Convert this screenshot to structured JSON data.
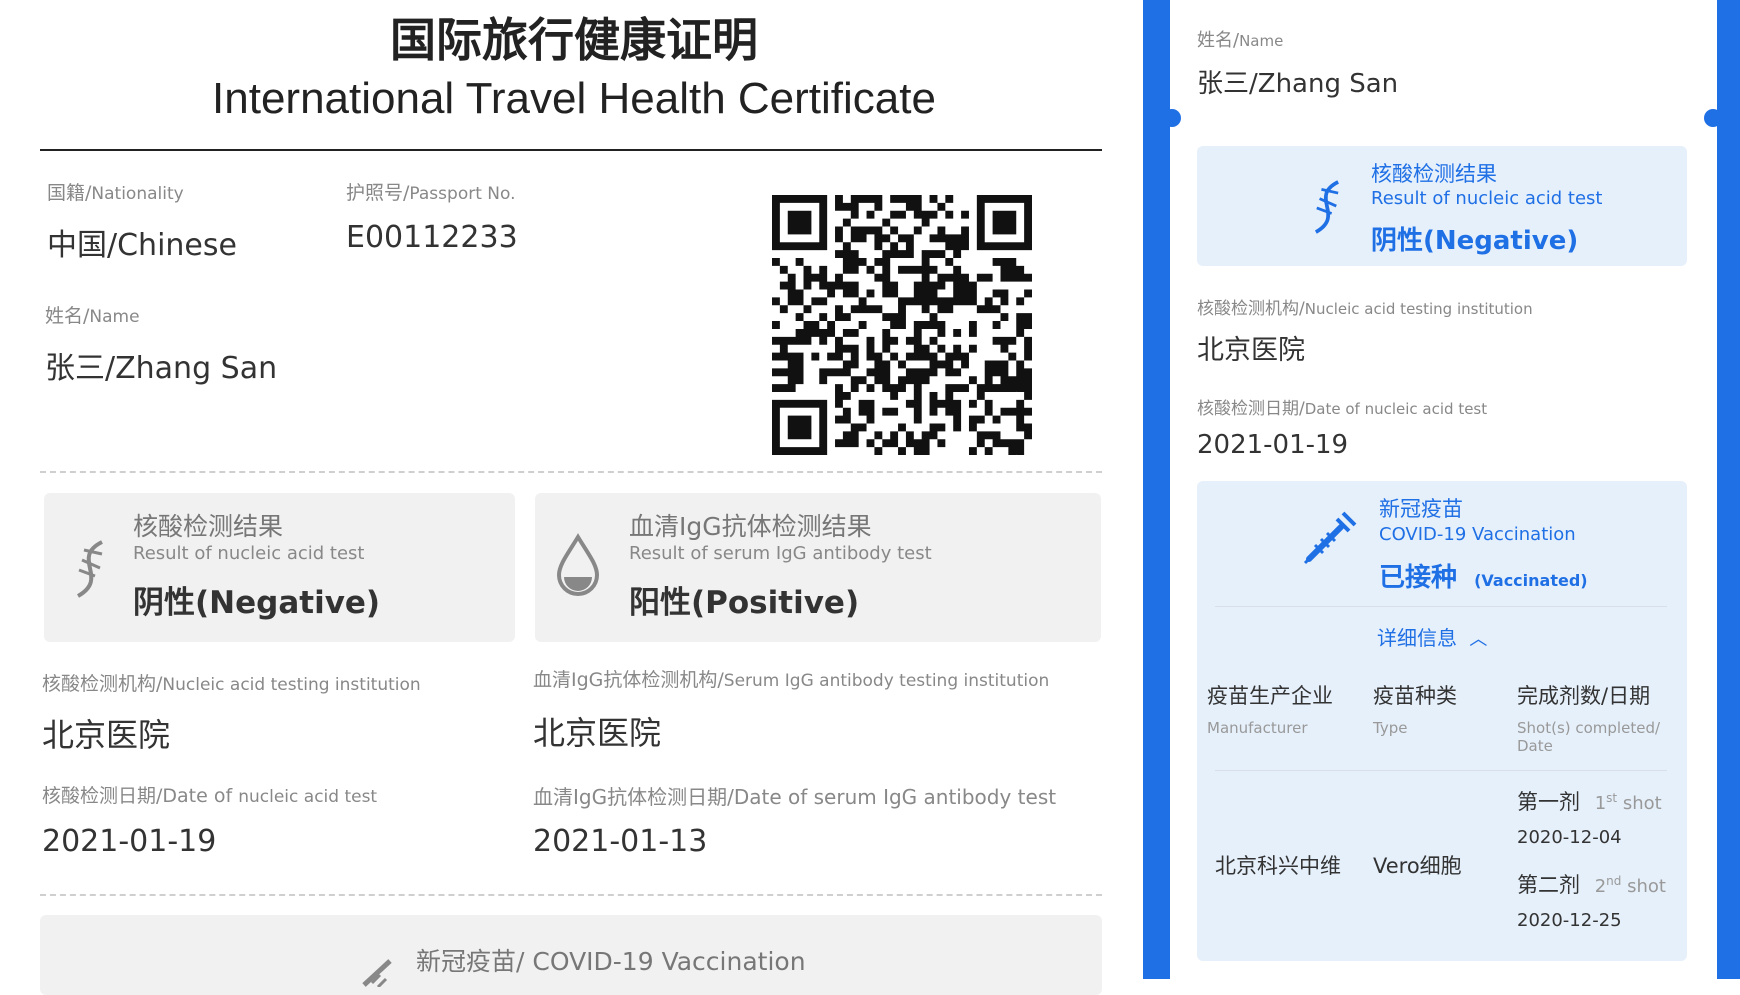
{
  "certificate": {
    "title_cn": "国际旅行健康证明",
    "title_en": "International Travel Health Certificate",
    "nationality_label_cn": "国籍/",
    "nationality_label_en": "Nationality",
    "nationality_value": "中国/Chinese",
    "passport_label_cn": "护照号/",
    "passport_label_en": "Passport No.",
    "passport_value": "E00112233",
    "name_label_cn": "姓名/",
    "name_label_en": "Name",
    "name_value": "张三/Zhang San",
    "nucleic_card": {
      "title_cn": "核酸检测结果",
      "title_en": "Result of nucleic acid  test",
      "result": "阴性(Negative)",
      "icon": "dna-icon"
    },
    "serum_card": {
      "title_cn": "血清IgG抗体检测结果",
      "title_en": "Result of serum IgG antibody test",
      "result": "阳性(Positive)",
      "icon": "blood-drop-icon"
    },
    "nucleic_inst_label_cn": "核酸检测机构/",
    "nucleic_inst_label_en": "Nucleic acid testing institution",
    "nucleic_inst_value": "北京医院",
    "serum_inst_label_cn": "血清IgG抗体检测机构/",
    "serum_inst_label_en": "Serum IgG antibody testing institution",
    "serum_inst_value": "北京医院",
    "nucleic_date_label_cn": "核酸检测日期/Date of ",
    "nucleic_date_label_en": "nucleic acid  test",
    "nucleic_date_value": "2021-01-19",
    "serum_date_label": "血清IgG抗体检测日期/Date of serum IgG antibody  test",
    "serum_date_value": "2021-01-13",
    "vaccine_label": "新冠疫苗/ COVID-19 Vaccination"
  },
  "mobile": {
    "name_label_cn": "姓名/",
    "name_label_en": "Name",
    "name_value": "张三/Zhang San",
    "nucleic_title_cn": "核酸检测结果",
    "nucleic_title_en": "Result of nucleic acid test",
    "nucleic_result": "阴性(Negative)",
    "inst_label_cn": "核酸检测机构/",
    "inst_label_en": "Nucleic acid testing institution",
    "inst_value": "北京医院",
    "date_label_cn": "核酸检测日期/",
    "date_label_en": "Date of nucleic acid  test",
    "date_value": "2021-01-19",
    "vaccine_title_cn": "新冠疫苗",
    "vaccine_title_en": "COVID-19 Vaccination",
    "vaccine_status": "已接种",
    "vaccine_status_en": "(Vaccinated)",
    "details_label": "详细信息",
    "col_manufacturer_cn": "疫苗生产企业",
    "col_manufacturer_en": "Manufacturer",
    "col_type_cn": "疫苗种类",
    "col_type_en": "Type",
    "col_shots_cn": "完成剂数/日期",
    "col_shots_en_1": "Shot(s) completed/",
    "col_shots_en_2": "Date",
    "manufacturer_value": "北京科兴中维",
    "type_value": "Vero细胞",
    "dose1_cn": "第一剂",
    "dose1_num": "1",
    "dose1_sup": "st",
    "dose1_en": "shot",
    "dose1_date": "2020-12-04",
    "dose2_cn": "第二剂",
    "dose2_num": "2",
    "dose2_sup": "nd",
    "dose2_en": "shot",
    "dose2_date": "2020-12-25"
  },
  "colors": {
    "accent_blue": "#1f6fe5",
    "card_blue": "#e6f0fb",
    "card_gray": "#f1f1f1"
  }
}
